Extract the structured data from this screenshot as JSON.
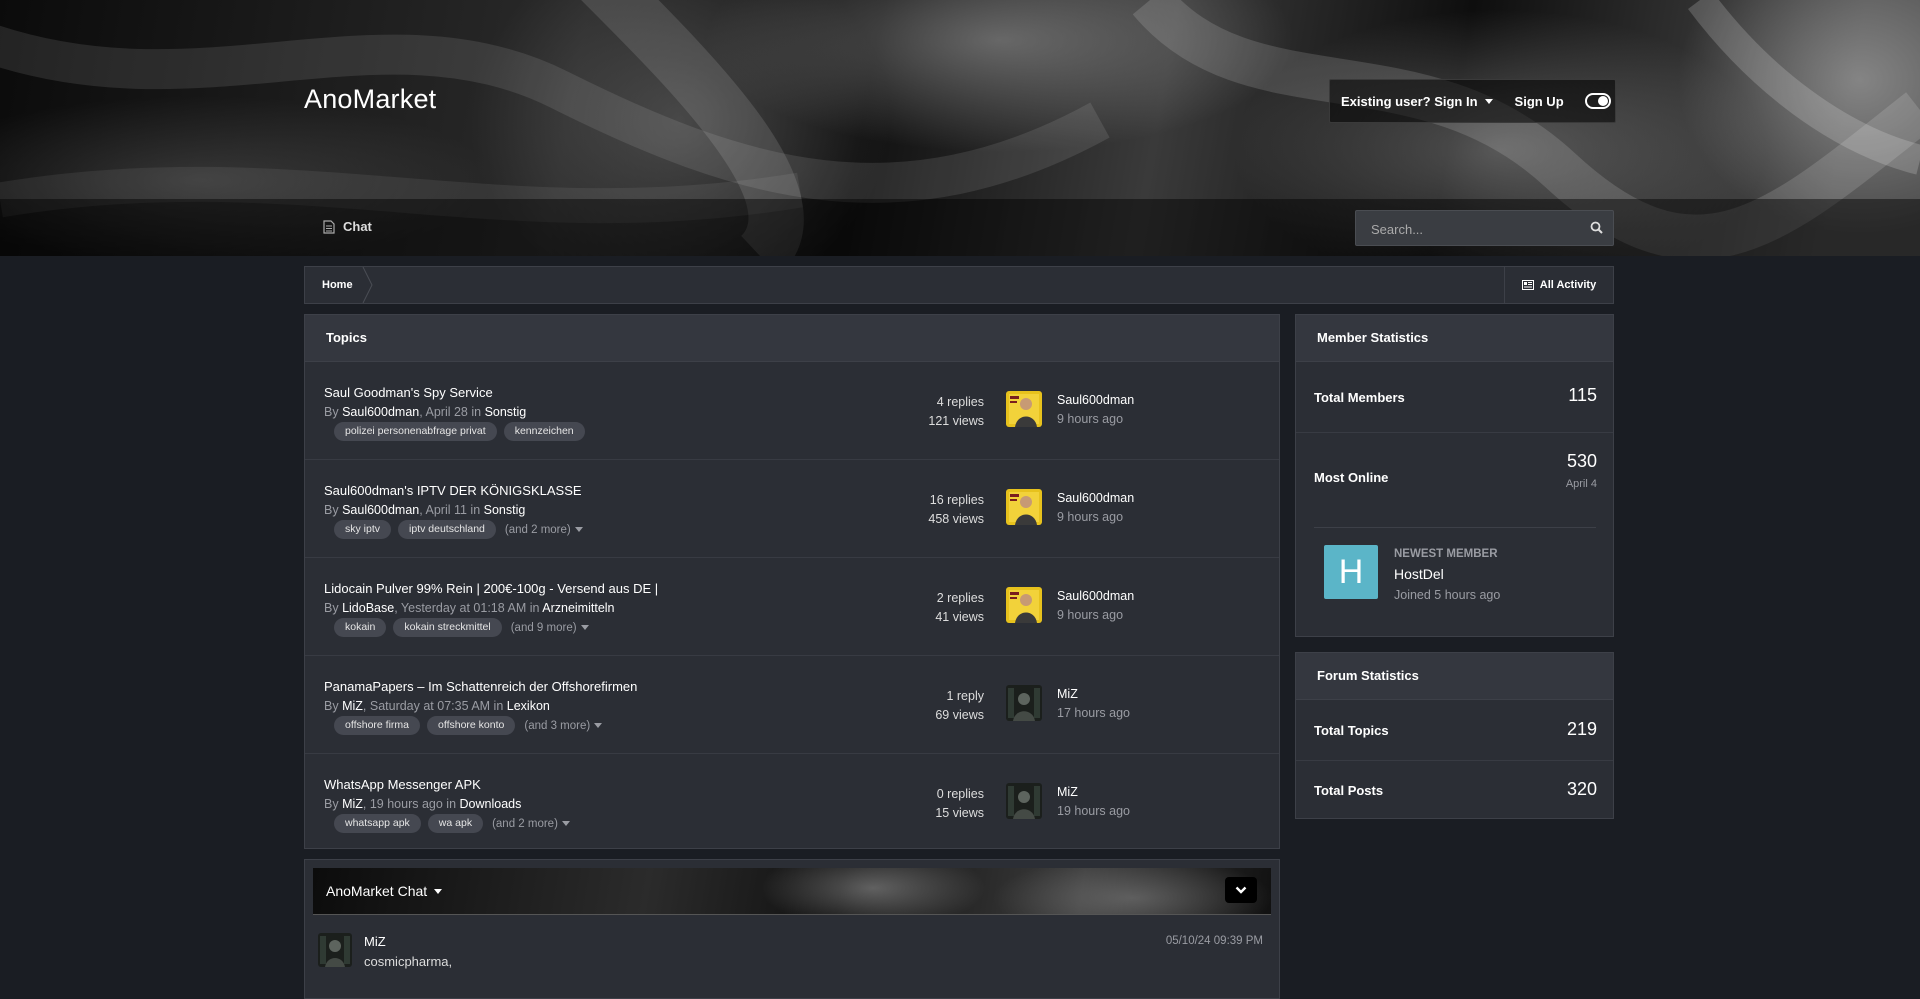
{
  "site": {
    "name": "AnoMarket"
  },
  "user_menu": {
    "signin_label": "Existing user? Sign In",
    "signup_label": "Sign Up"
  },
  "nav": {
    "chat_label": "Chat"
  },
  "search": {
    "placeholder": "Search..."
  },
  "breadcrumb": {
    "home": "Home",
    "all_activity": "All Activity"
  },
  "topics": {
    "title": "Topics",
    "items": [
      {
        "title": "Saul Goodman's Spy Service",
        "by": "By",
        "author": "Saul600dman",
        "date": ", April 28 in",
        "forum": "Sonstig",
        "tags": [
          "polizei personenabfrage privat",
          "kennzeichen"
        ],
        "more": "",
        "replies": "4 replies",
        "views": "121 views",
        "last_poster": "Saul600dman",
        "last_time": "9 hours ago",
        "avatar": "saul-avatar"
      },
      {
        "title": "Saul600dman's IPTV DER KÖNIGSKLASSE",
        "by": "By",
        "author": "Saul600dman",
        "date": ", April 11 in",
        "forum": "Sonstig",
        "tags": [
          "sky iptv",
          "iptv deutschland"
        ],
        "more": "(and 2 more)",
        "replies": "16 replies",
        "views": "458 views",
        "last_poster": "Saul600dman",
        "last_time": "9 hours ago",
        "avatar": "saul-avatar"
      },
      {
        "title": "Lidocain Pulver 99% Rein | 200€-100g - Versend aus DE |",
        "by": "By",
        "author": "LidoBase",
        "date": ", Yesterday at 01:18 AM in",
        "forum": "Arzneimitteln",
        "tags": [
          "kokain",
          "kokain streckmittel"
        ],
        "more": "(and 9 more)",
        "replies": "2 replies",
        "views": "41 views",
        "last_poster": "Saul600dman",
        "last_time": "9 hours ago",
        "avatar": "saul-avatar"
      },
      {
        "title": "PanamaPapers – Im Schattenreich der Offshorefirmen",
        "by": "By",
        "author": "MiZ",
        "date": ", Saturday at 07:35 AM in",
        "forum": "Lexikon",
        "tags": [
          "offshore firma",
          "offshore konto"
        ],
        "more": "(and 3 more)",
        "replies": "1 reply",
        "views": "69 views",
        "last_poster": "MiZ",
        "last_time": "17 hours ago",
        "avatar": "miz-avatar"
      },
      {
        "title": "WhatsApp Messenger APK",
        "by": "By",
        "author": "MiZ",
        "date": ", 19 hours ago in",
        "forum": "Downloads",
        "tags": [
          "whatsapp apk",
          "wa apk"
        ],
        "more": "(and 2 more)",
        "replies": "0 replies",
        "views": "15 views",
        "last_poster": "MiZ",
        "last_time": "19 hours ago",
        "avatar": "miz-avatar"
      }
    ]
  },
  "chat": {
    "title": "AnoMarket Chat",
    "message": {
      "user": "MiZ",
      "text": "cosmicpharma,",
      "time": "05/10/24 09:39 PM"
    }
  },
  "member_stats": {
    "title": "Member Statistics",
    "total_members_label": "Total Members",
    "total_members": "115",
    "most_online_label": "Most Online",
    "most_online": "530",
    "most_online_date": "April 4",
    "newest_label": "Newest Member",
    "newest_initial": "H",
    "newest_name": "HostDel",
    "newest_joined": "Joined 5 hours ago",
    "newest_avatar_color": "#5bb5c8"
  },
  "forum_stats": {
    "title": "Forum Statistics",
    "total_topics_label": "Total Topics",
    "total_topics": "219",
    "total_posts_label": "Total Posts",
    "total_posts": "320"
  }
}
